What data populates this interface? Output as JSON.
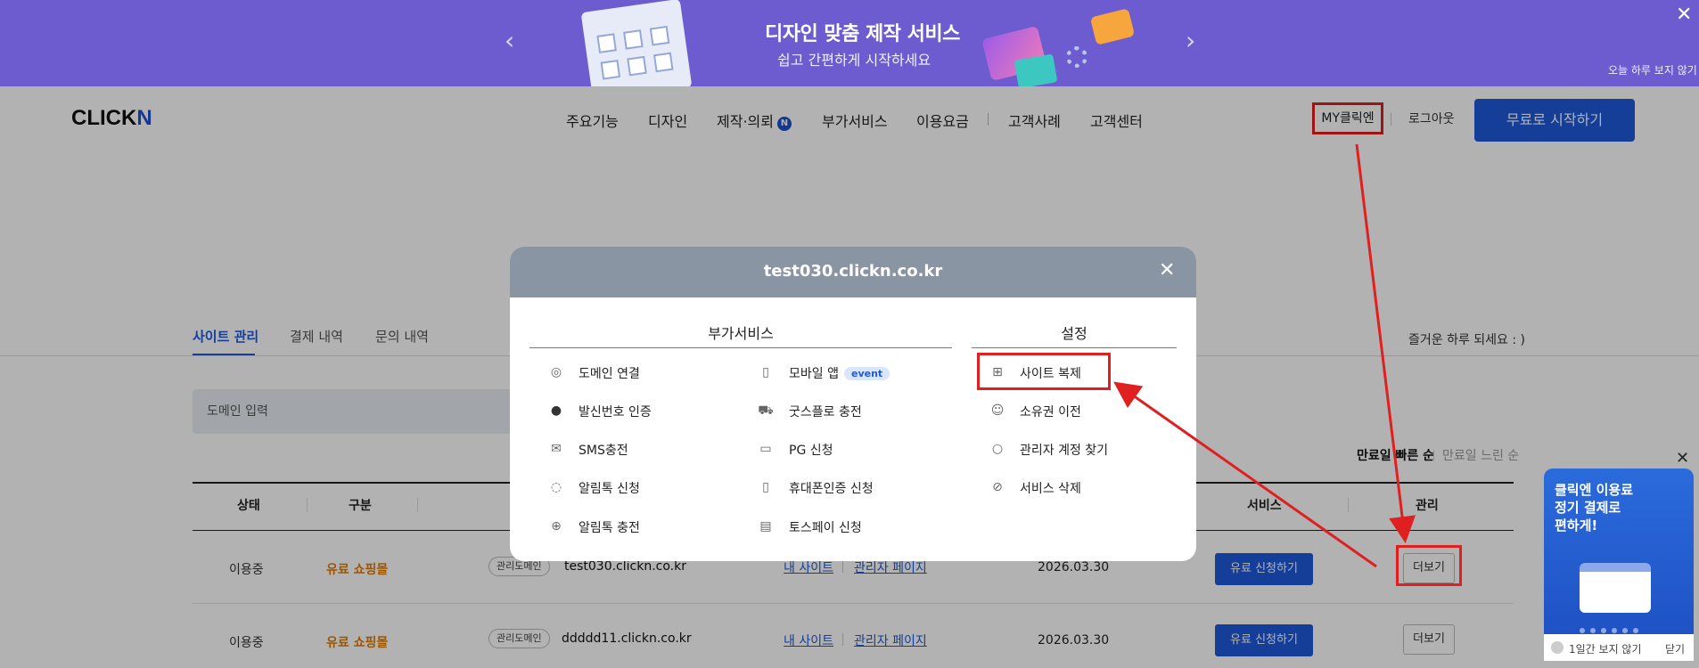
{
  "banner": {
    "title": "디자인 맞춤 제작 서비스",
    "subtitle": "쉽고 간편하게 시작하세요",
    "today_hide": "오늘 하루 보지 않기",
    "prev_icon": "‹",
    "next_icon": "›",
    "close_icon": "✕"
  },
  "header": {
    "logo_main": "CLICK",
    "logo_accent": "N",
    "nav": [
      "주요기능",
      "디자인",
      "제작·의뢰",
      "부가서비스",
      "이용요금",
      "고객사례",
      "고객센터"
    ],
    "nav_badge": "N",
    "my": "MY클릭엔",
    "logout": "로그아웃",
    "start": "무료로 시작하기"
  },
  "page": {
    "tabs": [
      "사이트 관리",
      "결제 내역",
      "문의 내역"
    ],
    "greeting": "즐거운 하루 되세요 : )",
    "search_placeholder": "도메인 입력",
    "sort_fast": "만료일 빠른 순",
    "sort_slow": "만료일 느린 순",
    "columns": {
      "status": "상태",
      "kind": "구분",
      "service": "서비스",
      "manage": "관리"
    },
    "rows": [
      {
        "status": "이용중",
        "kind": "유료 쇼핑몰",
        "pill": "관리도메인",
        "domain": "test030.clickn.co.kr",
        "my_site": "내 사이트",
        "admin": "관리자 페이지",
        "date": "2026.03.30",
        "apply": "유료 신청하기",
        "more": "더보기"
      },
      {
        "status": "이용중",
        "kind": "유료 쇼핑몰",
        "pill": "관리도메인",
        "domain": "ddddd11.clickn.co.kr",
        "my_site": "내 사이트",
        "admin": "관리자 페이지",
        "date": "2026.03.30",
        "apply": "유료 신청하기",
        "more": "더보기"
      }
    ]
  },
  "modal": {
    "title": "test030.clickn.co.kr",
    "close_icon": "✕",
    "addons_title": "부가서비스",
    "settings_title": "설정",
    "addons_left": [
      "도메인 연결",
      "발신번호 인증",
      "SMS충전",
      "알림톡 신청",
      "알림톡 충전"
    ],
    "addons_right": [
      "모바일 앱",
      "굿스플로 충전",
      "PG 신청",
      "휴대폰인증 신청",
      "토스페이 신청"
    ],
    "event_badge": "event",
    "settings": [
      "사이트 복제",
      "소유권 이전",
      "관리자 계정 찾기",
      "서비스 삭제"
    ]
  },
  "promo": {
    "line1": "클릭엔 이용료",
    "line2": "정기 결제로",
    "line3": "편하게!",
    "dont_show": "1일간 보지 않기",
    "close": "닫기",
    "close_icon": "✕"
  },
  "colors": {
    "banner": "#6d5bd0",
    "accent": "#1e59d8",
    "highlight": "#e02020",
    "kind": "#e07b00"
  }
}
